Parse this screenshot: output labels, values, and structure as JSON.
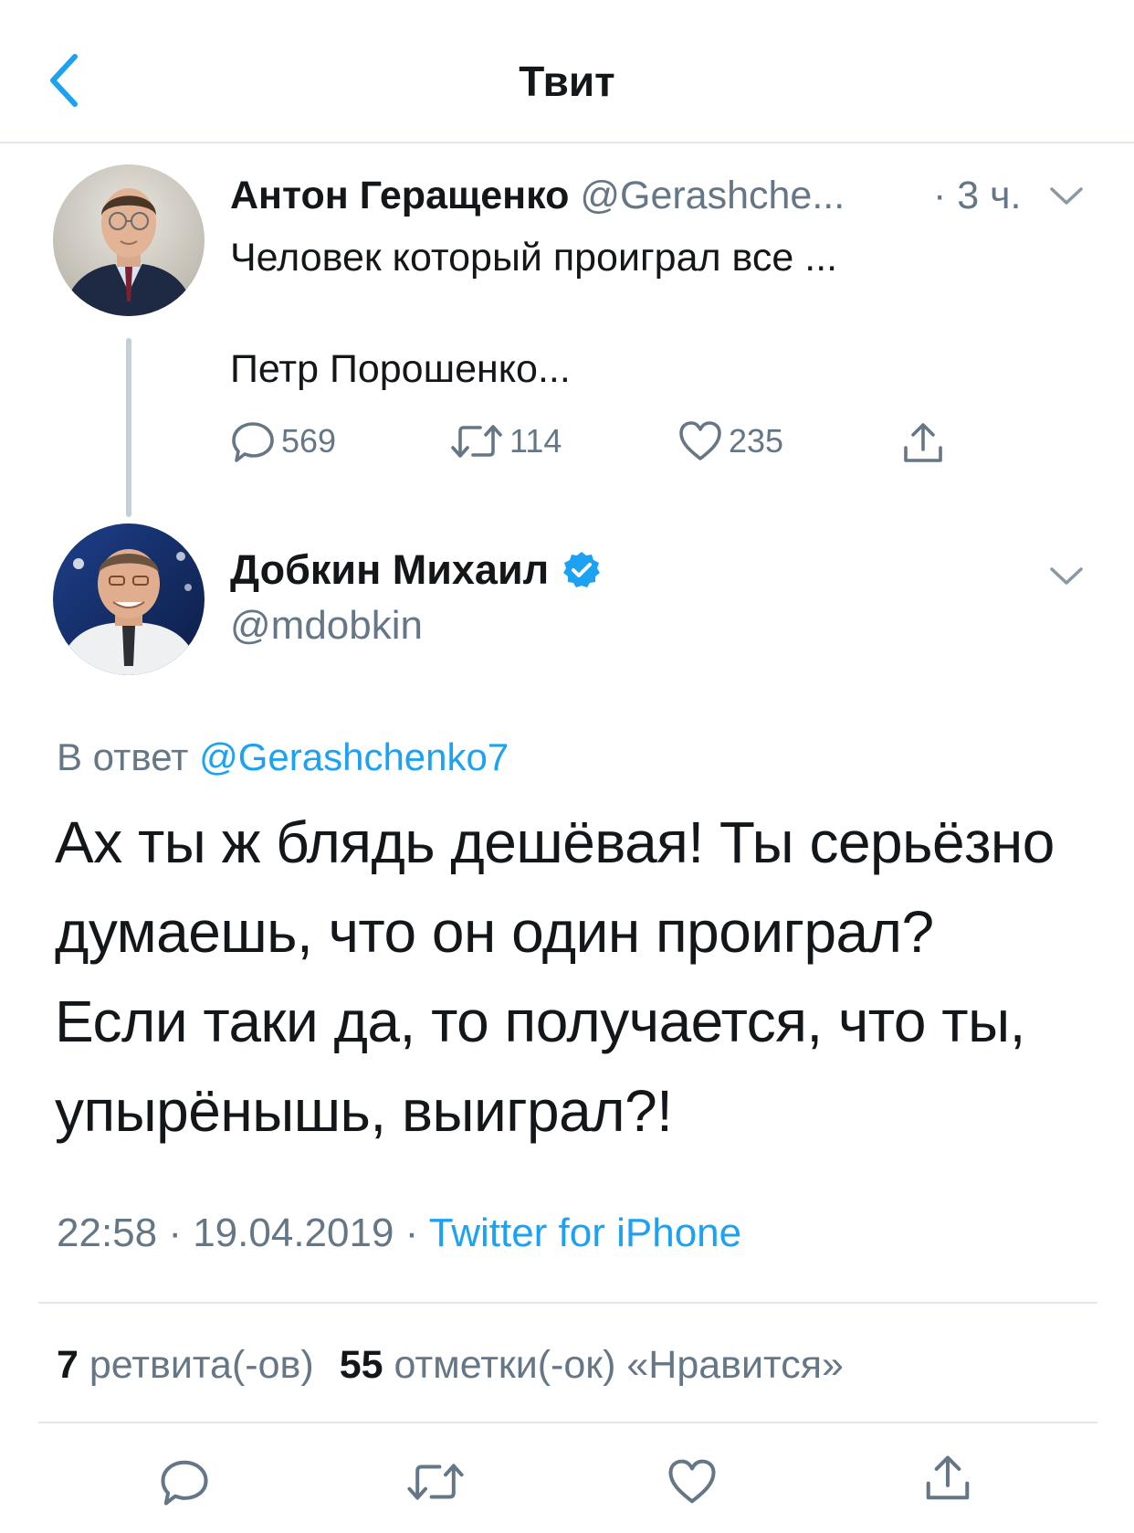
{
  "nav": {
    "title": "Твит",
    "back_icon": "chevron-left-icon"
  },
  "parent": {
    "name": "Антон Геращенко",
    "handle": "@Gerashche...",
    "time": "· 3 ч.",
    "text_line1": "Человек который проиграл все ...",
    "text_line2": "Петр Порошенко...",
    "replies": "569",
    "retweets": "114",
    "likes": "235"
  },
  "tweet": {
    "name": "Добкин Михаил",
    "verified": true,
    "handle": "@mdobkin",
    "reply_prefix": "В ответ",
    "reply_to": "@Gerashchenko7",
    "body_lines": [
      "Ах ты ж блядь дешёвая! Ты серьёзно",
      "думаешь, что он один проиграл?",
      "Если таки да, то получается, что ты,",
      "упырёнышь, выиграл?!"
    ],
    "time": "22:58 · 19.04.2019 ·",
    "source": "Twitter for iPhone",
    "retweet_count": "7",
    "retweet_label": "ретвита(-ов)",
    "like_count": "55",
    "like_label": "отметки(-ок) «Нравится»"
  },
  "colors": {
    "accent": "#1da1f2",
    "muted": "#657786",
    "text": "#14171a",
    "divider": "#e1e8ed"
  }
}
